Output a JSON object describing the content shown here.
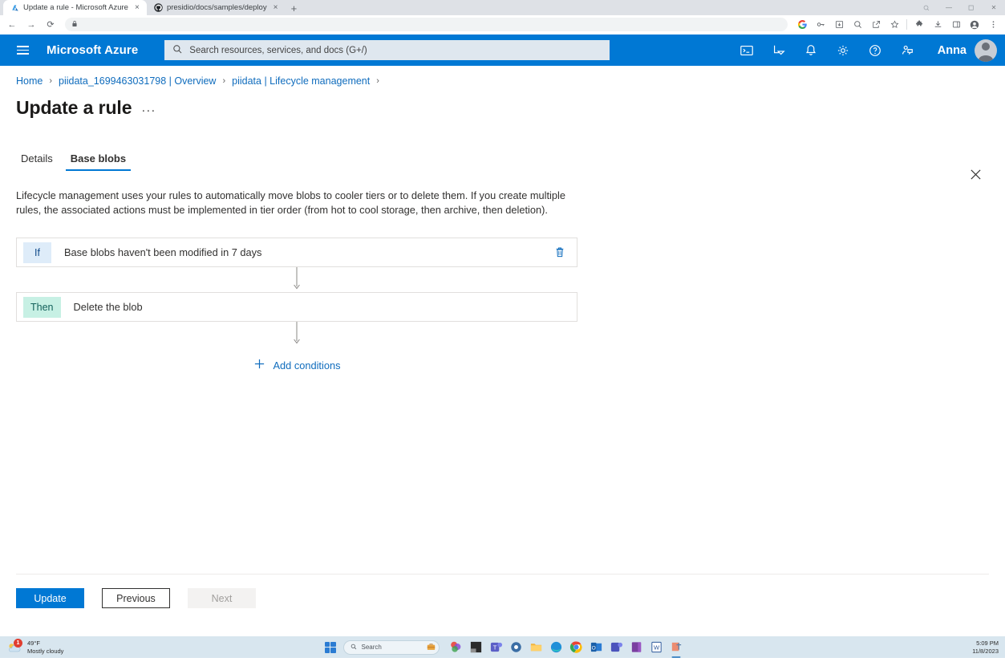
{
  "browser": {
    "tabs": [
      {
        "title": "Update a rule - Microsoft Azure",
        "favicon": "azure-icon",
        "active": true,
        "close_label": "×"
      },
      {
        "title": "presidio/docs/samples/deploy",
        "favicon": "github-icon",
        "active": false,
        "close_label": "×"
      }
    ],
    "new_tab_label": "+",
    "window_controls": {
      "minimize": "—",
      "maximize": "❐",
      "close": "✕",
      "restore": "⬜"
    },
    "nav": {
      "back": "←",
      "forward": "→",
      "reload": "⟳"
    },
    "omnibox": {
      "lock_icon": "lock-icon",
      "value": "",
      "placeholder": ""
    },
    "toolbar_right_icons": [
      "google-icon",
      "password-key-icon",
      "install-app-icon",
      "zoom-icon",
      "share-icon",
      "bookmark-star-icon",
      "extensions-puzzle-icon",
      "downloads-icon",
      "side-panel-icon",
      "profile-avatar-icon",
      "chrome-menu-icon"
    ]
  },
  "azure_header": {
    "menu_label": "Show portal menu",
    "brand": "Microsoft Azure",
    "search": {
      "placeholder": "Search resources, services, and docs (G+/)",
      "value": "",
      "icon": "search-icon"
    },
    "icons": [
      "cloud-shell-icon",
      "directories-subscriptions-icon",
      "notifications-bell-icon",
      "settings-gear-icon",
      "help-question-icon",
      "feedback-icon"
    ],
    "user_name": "Anna"
  },
  "breadcrumb": {
    "items": [
      {
        "label": "Home"
      },
      {
        "label": "piidata_1699463031798 | Overview"
      },
      {
        "label": "piidata | Lifecycle management"
      }
    ],
    "separator": "›"
  },
  "page": {
    "title": "Update a rule",
    "more_actions": "···",
    "close_label": "✕",
    "tabs": [
      {
        "label": "Details",
        "selected": false
      },
      {
        "label": "Base blobs",
        "selected": true
      }
    ],
    "description": "Lifecycle management uses your rules to automatically move blobs to cooler tiers or to delete them. If you create multiple rules, the associated actions must be implemented in tier order (from hot to cool storage, then archive, then deletion).",
    "rules": [
      {
        "badge": "If",
        "badge_type": "if",
        "text": "Base blobs haven't been modified in 7 days",
        "delete_icon": "trash-icon",
        "has_delete": true
      },
      {
        "badge": "Then",
        "badge_type": "then",
        "text": "Delete the blob",
        "has_delete": false
      }
    ],
    "add_conditions": {
      "icon": "plus-icon",
      "label": "Add conditions"
    },
    "actions": [
      {
        "label": "Update",
        "style": "primary"
      },
      {
        "label": "Previous",
        "style": "secondary"
      },
      {
        "label": "Next",
        "style": "disabled"
      }
    ]
  },
  "taskbar": {
    "weather": {
      "temperature": "49°F",
      "condition": "Mostly cloudy",
      "badge": "1",
      "icon": "cloud-sun-icon"
    },
    "start_label": "Start",
    "search": {
      "placeholder": "Search",
      "value": "",
      "icon": "search-icon",
      "widget_icon": "briefcase-icon"
    },
    "apps": [
      "copilot-icon",
      "dark-square-icon",
      "teams-icon",
      "settings-icon",
      "file-explorer-icon",
      "edge-icon",
      "chrome-icon",
      "outlook-icon",
      "teams-chat-icon",
      "onenote-icon",
      "word-icon",
      "active-app-icon"
    ],
    "clock": {
      "time": "5:09 PM",
      "date": "11/8/2023"
    }
  },
  "colors": {
    "azure_blue": "#0078d4",
    "link_blue": "#0f6cbd",
    "if_badge_bg": "#deecf9",
    "then_badge_bg": "#c7f0e4",
    "taskbar_bg": "#d8e6ef"
  }
}
